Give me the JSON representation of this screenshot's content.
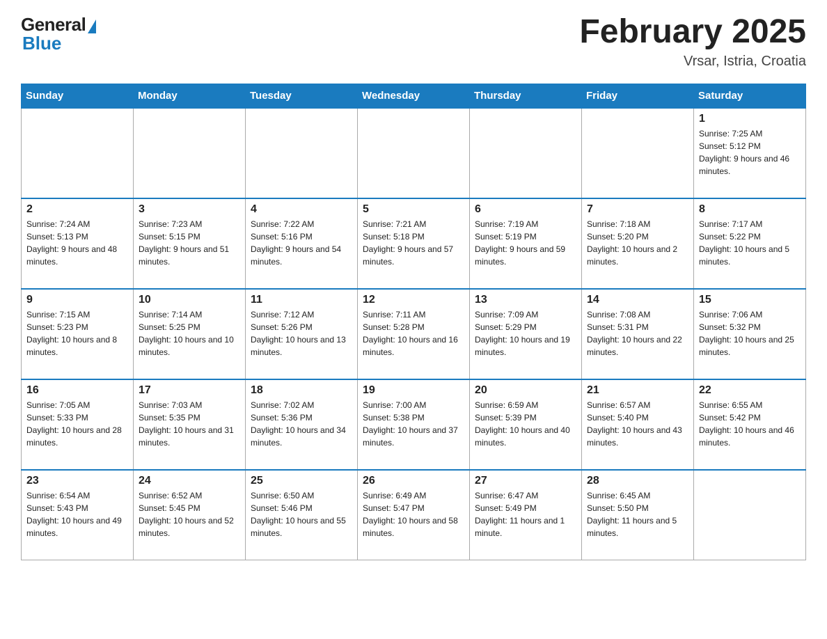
{
  "logo": {
    "general": "General",
    "blue": "Blue"
  },
  "title": "February 2025",
  "subtitle": "Vrsar, Istria, Croatia",
  "days_of_week": [
    "Sunday",
    "Monday",
    "Tuesday",
    "Wednesday",
    "Thursday",
    "Friday",
    "Saturday"
  ],
  "weeks": [
    [
      {
        "day": "",
        "info": "",
        "empty": true
      },
      {
        "day": "",
        "info": "",
        "empty": true
      },
      {
        "day": "",
        "info": "",
        "empty": true
      },
      {
        "day": "",
        "info": "",
        "empty": true
      },
      {
        "day": "",
        "info": "",
        "empty": true
      },
      {
        "day": "",
        "info": "",
        "empty": true
      },
      {
        "day": "1",
        "info": "Sunrise: 7:25 AM\nSunset: 5:12 PM\nDaylight: 9 hours and 46 minutes."
      }
    ],
    [
      {
        "day": "2",
        "info": "Sunrise: 7:24 AM\nSunset: 5:13 PM\nDaylight: 9 hours and 48 minutes."
      },
      {
        "day": "3",
        "info": "Sunrise: 7:23 AM\nSunset: 5:15 PM\nDaylight: 9 hours and 51 minutes."
      },
      {
        "day": "4",
        "info": "Sunrise: 7:22 AM\nSunset: 5:16 PM\nDaylight: 9 hours and 54 minutes."
      },
      {
        "day": "5",
        "info": "Sunrise: 7:21 AM\nSunset: 5:18 PM\nDaylight: 9 hours and 57 minutes."
      },
      {
        "day": "6",
        "info": "Sunrise: 7:19 AM\nSunset: 5:19 PM\nDaylight: 9 hours and 59 minutes."
      },
      {
        "day": "7",
        "info": "Sunrise: 7:18 AM\nSunset: 5:20 PM\nDaylight: 10 hours and 2 minutes."
      },
      {
        "day": "8",
        "info": "Sunrise: 7:17 AM\nSunset: 5:22 PM\nDaylight: 10 hours and 5 minutes."
      }
    ],
    [
      {
        "day": "9",
        "info": "Sunrise: 7:15 AM\nSunset: 5:23 PM\nDaylight: 10 hours and 8 minutes."
      },
      {
        "day": "10",
        "info": "Sunrise: 7:14 AM\nSunset: 5:25 PM\nDaylight: 10 hours and 10 minutes."
      },
      {
        "day": "11",
        "info": "Sunrise: 7:12 AM\nSunset: 5:26 PM\nDaylight: 10 hours and 13 minutes."
      },
      {
        "day": "12",
        "info": "Sunrise: 7:11 AM\nSunset: 5:28 PM\nDaylight: 10 hours and 16 minutes."
      },
      {
        "day": "13",
        "info": "Sunrise: 7:09 AM\nSunset: 5:29 PM\nDaylight: 10 hours and 19 minutes."
      },
      {
        "day": "14",
        "info": "Sunrise: 7:08 AM\nSunset: 5:31 PM\nDaylight: 10 hours and 22 minutes."
      },
      {
        "day": "15",
        "info": "Sunrise: 7:06 AM\nSunset: 5:32 PM\nDaylight: 10 hours and 25 minutes."
      }
    ],
    [
      {
        "day": "16",
        "info": "Sunrise: 7:05 AM\nSunset: 5:33 PM\nDaylight: 10 hours and 28 minutes."
      },
      {
        "day": "17",
        "info": "Sunrise: 7:03 AM\nSunset: 5:35 PM\nDaylight: 10 hours and 31 minutes."
      },
      {
        "day": "18",
        "info": "Sunrise: 7:02 AM\nSunset: 5:36 PM\nDaylight: 10 hours and 34 minutes."
      },
      {
        "day": "19",
        "info": "Sunrise: 7:00 AM\nSunset: 5:38 PM\nDaylight: 10 hours and 37 minutes."
      },
      {
        "day": "20",
        "info": "Sunrise: 6:59 AM\nSunset: 5:39 PM\nDaylight: 10 hours and 40 minutes."
      },
      {
        "day": "21",
        "info": "Sunrise: 6:57 AM\nSunset: 5:40 PM\nDaylight: 10 hours and 43 minutes."
      },
      {
        "day": "22",
        "info": "Sunrise: 6:55 AM\nSunset: 5:42 PM\nDaylight: 10 hours and 46 minutes."
      }
    ],
    [
      {
        "day": "23",
        "info": "Sunrise: 6:54 AM\nSunset: 5:43 PM\nDaylight: 10 hours and 49 minutes."
      },
      {
        "day": "24",
        "info": "Sunrise: 6:52 AM\nSunset: 5:45 PM\nDaylight: 10 hours and 52 minutes."
      },
      {
        "day": "25",
        "info": "Sunrise: 6:50 AM\nSunset: 5:46 PM\nDaylight: 10 hours and 55 minutes."
      },
      {
        "day": "26",
        "info": "Sunrise: 6:49 AM\nSunset: 5:47 PM\nDaylight: 10 hours and 58 minutes."
      },
      {
        "day": "27",
        "info": "Sunrise: 6:47 AM\nSunset: 5:49 PM\nDaylight: 11 hours and 1 minute."
      },
      {
        "day": "28",
        "info": "Sunrise: 6:45 AM\nSunset: 5:50 PM\nDaylight: 11 hours and 5 minutes."
      },
      {
        "day": "",
        "info": "",
        "empty": true
      }
    ]
  ]
}
